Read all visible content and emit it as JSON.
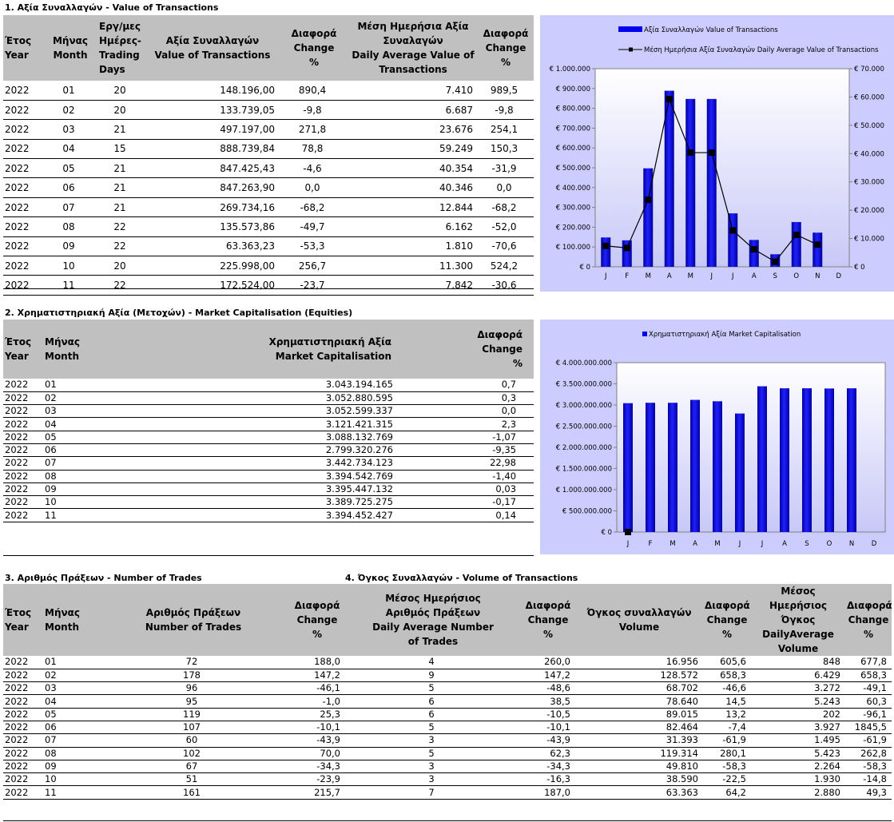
{
  "sec1": {
    "title": "1. Αξία Συναλλαγών - Value of Transactions",
    "headers": [
      "Έτος Year",
      "Μήνας Month",
      "Εργ/μες Ημέρες- Trading Days",
      "Αξία Συναλλαγών Value of Transactions",
      "Διαφορά Change %",
      "Μέση Ημερήσια Αξία Συναλαγών Daily Average Value of Transactions",
      "Διαφορά Change %"
    ],
    "rows": [
      [
        "2022",
        "01",
        "20",
        "148.196,00",
        "890,4",
        "7.410",
        "989,5"
      ],
      [
        "2022",
        "02",
        "20",
        "133.739,05",
        "-9,8",
        "6.687",
        "-9,8"
      ],
      [
        "2022",
        "03",
        "21",
        "497.197,00",
        "271,8",
        "23.676",
        "254,1"
      ],
      [
        "2022",
        "04",
        "15",
        "888.739,84",
        "78,8",
        "59.249",
        "150,3"
      ],
      [
        "2022",
        "05",
        "21",
        "847.425,43",
        "-4,6",
        "40.354",
        "-31,9"
      ],
      [
        "2022",
        "06",
        "21",
        "847.263,90",
        "0,0",
        "40.346",
        "0,0"
      ],
      [
        "2022",
        "07",
        "21",
        "269.734,16",
        "-68,2",
        "12.844",
        "-68,2"
      ],
      [
        "2022",
        "08",
        "22",
        "135.573,86",
        "-49,7",
        "6.162",
        "-52,0"
      ],
      [
        "2022",
        "09",
        "22",
        "63.363,23",
        "-53,3",
        "1.810",
        "-70,6"
      ],
      [
        "2022",
        "10",
        "20",
        "225.998,00",
        "256,7",
        "11.300",
        "524,2"
      ],
      [
        "2022",
        "11",
        "22",
        "172.524,00",
        "-23,7",
        "7.842",
        "-30,6"
      ]
    ]
  },
  "sec2": {
    "title": "2. Χρηματιστηριακή Αξία (Μετοχών) - Market Capitalisation (Equities)",
    "headers": [
      "Έτος Year",
      "Μήνας Month",
      "Χρηματιστηριακή Αξία Market Capitalisation",
      "Διαφορά Change %"
    ],
    "rows": [
      [
        "2022",
        "01",
        "3.043.194.165",
        "0,7"
      ],
      [
        "2022",
        "02",
        "3.052.880.595",
        "0,3"
      ],
      [
        "2022",
        "03",
        "3.052.599.337",
        "0,0"
      ],
      [
        "2022",
        "04",
        "3.121.421.315",
        "2,3"
      ],
      [
        "2022",
        "05",
        "3.088.132.769",
        "-1,07"
      ],
      [
        "2022",
        "06",
        "2.799.320.276",
        "-9,35"
      ],
      [
        "2022",
        "07",
        "3.442.734.123",
        "22,98"
      ],
      [
        "2022",
        "08",
        "3.394.542.769",
        "-1,40"
      ],
      [
        "2022",
        "09",
        "3.395.447.132",
        "0,03"
      ],
      [
        "2022",
        "10",
        "3.389.725.275",
        "-0,17"
      ],
      [
        "2022",
        "11",
        "3.394.452.427",
        "0,14"
      ]
    ]
  },
  "sec3": {
    "title": "3. Αριθμός Πράξεων - Number of Trades",
    "title4": "4. Όγκος Συναλλαγών - Volume of Transactions",
    "headers": [
      "Έτος Year",
      "Μήνας Month",
      "Αριθμός Πράξεων Number of Trades",
      "Διαφορά Change %",
      "Μέσος Ημερήσιος Αριθμός Πράξεων Daily Average Number of Trades",
      "Διαφορά Change %",
      "Όγκος συναλλαγών Volume",
      "Διαφορά Change %",
      "Μέσος Ημερήσιος Όγκος DailyAverage Volume",
      "Διαφορά Change %"
    ],
    "rows": [
      [
        "2022",
        "01",
        "72",
        "188,0",
        "4",
        "260,0",
        "16.956",
        "605,6",
        "848",
        "677,8"
      ],
      [
        "2022",
        "02",
        "178",
        "147,2",
        "9",
        "147,2",
        "128.572",
        "658,3",
        "6.429",
        "658,3"
      ],
      [
        "2022",
        "03",
        "96",
        "-46,1",
        "5",
        "-48,6",
        "68.702",
        "-46,6",
        "3.272",
        "-49,1"
      ],
      [
        "2022",
        "04",
        "95",
        "-1,0",
        "6",
        "38,5",
        "78.640",
        "14,5",
        "5.243",
        "60,3"
      ],
      [
        "2022",
        "05",
        "119",
        "25,3",
        "6",
        "-10,5",
        "89.015",
        "13,2",
        "202",
        "-96,1"
      ],
      [
        "2022",
        "06",
        "107",
        "-10,1",
        "5",
        "-10,1",
        "82.464",
        "-7,4",
        "3.927",
        "1845,5"
      ],
      [
        "2022",
        "07",
        "60",
        "-43,9",
        "3",
        "-43,9",
        "31.393",
        "-61,9",
        "1.495",
        "-61,9"
      ],
      [
        "2022",
        "08",
        "102",
        "70,0",
        "5",
        "62,3",
        "119.314",
        "280,1",
        "5.423",
        "262,8"
      ],
      [
        "2022",
        "09",
        "67",
        "-34,3",
        "3",
        "-34,3",
        "49.810",
        "-58,3",
        "2.264",
        "-58,3"
      ],
      [
        "2022",
        "10",
        "51",
        "-23,9",
        "3",
        "-16,3",
        "38.590",
        "-22,5",
        "1.930",
        "-14,8"
      ],
      [
        "2022",
        "11",
        "161",
        "215,7",
        "7",
        "187,0",
        "63.363",
        "64,2",
        "2.880",
        "49,3"
      ]
    ]
  },
  "chart_data": [
    {
      "type": "bar",
      "legend": [
        "Αξία Συναλλαγών Value of Transactions",
        "Μέση Ημερήσια Αξία Συναλαγών Daily Average Value of Transactions"
      ],
      "categories": [
        "J",
        "F",
        "M",
        "A",
        "M",
        "J",
        "J",
        "A",
        "S",
        "O",
        "N",
        "D"
      ],
      "series": [
        {
          "name": "Αξία Συναλλαγών Value of Transactions",
          "type": "bar",
          "axis": "left",
          "values": [
            148196.0,
            133739.05,
            497197.0,
            888739.84,
            847425.43,
            847263.9,
            269734.16,
            135573.86,
            63363.23,
            225998.0,
            172524.0,
            null
          ]
        },
        {
          "name": "Μέση Ημερήσια Αξία Συναλαγών Daily Average Value of Transactions",
          "type": "line",
          "axis": "right",
          "values": [
            7410,
            6687,
            23676,
            59249,
            40354,
            40346,
            12844,
            6162,
            1810,
            11300,
            7842,
            null
          ]
        }
      ],
      "ylim": [
        0,
        1000000
      ],
      "y2lim": [
        0,
        70000
      ],
      "yticks": [
        "€ 0",
        "€ 100.000",
        "€ 200.000",
        "€ 300.000",
        "€ 400.000",
        "€ 500.000",
        "€ 600.000",
        "€ 700.000",
        "€ 800.000",
        "€ 900.000",
        "€ 1.000.000"
      ],
      "y2ticks": [
        "€ 0",
        "€ 10.000",
        "€ 20.000",
        "€ 30.000",
        "€ 40.000",
        "€ 50.000",
        "€ 60.000",
        "€ 70.000"
      ],
      "grid": false,
      "legend_placement": "top",
      "colors": {
        "bar": "#0000ee",
        "line": "#000000",
        "bg": "#ccccff"
      }
    },
    {
      "type": "bar",
      "legend": [
        "Χρηματιστηριακή Αξία Market Capitalisation"
      ],
      "categories": [
        "J",
        "F",
        "M",
        "A",
        "M",
        "J",
        "J",
        "A",
        "S",
        "O",
        "N",
        "D"
      ],
      "series": [
        {
          "name": "Χρηματιστηριακή Αξία Market Capitalisation",
          "values": [
            3043194165,
            3052880595,
            3052599337,
            3121421315,
            3088132769,
            2799320276,
            3442734123,
            3394542769,
            3395447132,
            3389725275,
            3394452427,
            null
          ]
        }
      ],
      "ylim": [
        0,
        4000000000
      ],
      "yticks": [
        "€ 0",
        "€ 500.000.000",
        "€ 1.000.000.000",
        "€ 1.500.000.000",
        "€ 2.000.000.000",
        "€ 2.500.000.000",
        "€ 3.000.000.000",
        "€ 3.500.000.000",
        "€ 4.000.000.000"
      ],
      "grid": false,
      "legend_placement": "top",
      "colors": {
        "bar": "#0000ee",
        "bg": "#ccccff"
      }
    }
  ]
}
